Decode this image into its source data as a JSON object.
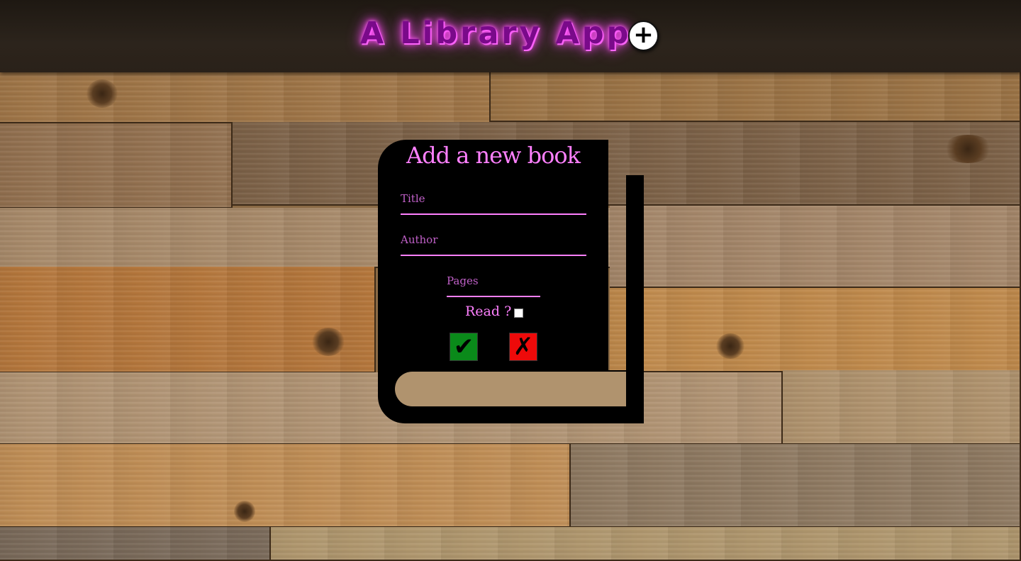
{
  "header": {
    "title": "A Library App",
    "add_button_label": "+"
  },
  "form": {
    "title": "Add a new book",
    "title_field": {
      "placeholder": "Title",
      "value": ""
    },
    "author_field": {
      "placeholder": "Author",
      "value": ""
    },
    "pages_field": {
      "placeholder": "Pages",
      "value": ""
    },
    "read_label": "Read ?",
    "read_checked": false,
    "confirm_label": "✔",
    "cancel_label": "✗"
  },
  "colors": {
    "accent": "#ff80ff",
    "header_bg": "#2a2119",
    "confirm": "#0a8a1a",
    "cancel": "#ee0a0a",
    "book": "#000000"
  },
  "icons": {
    "add": "plus-icon",
    "confirm": "checkmark-icon",
    "cancel": "cross-icon"
  }
}
